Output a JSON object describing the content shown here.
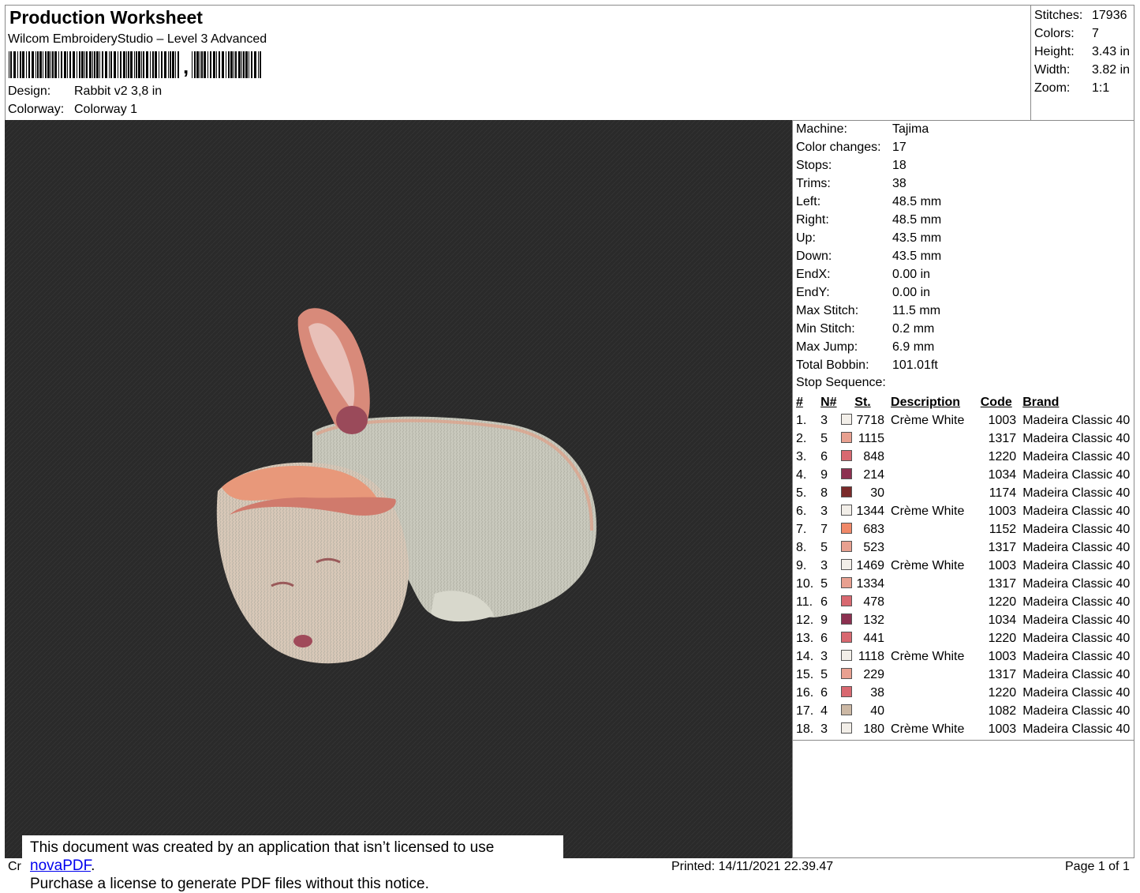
{
  "header": {
    "title": "Production Worksheet",
    "software": "Wilcom EmbroideryStudio – Level 3 Advanced",
    "design_label": "Design:",
    "design_value": "Rabbit v2 3,8 in",
    "colorway_label": "Colorway:",
    "colorway_value": "Colorway 1"
  },
  "stats": [
    {
      "label": "Stitches:",
      "value": "17936"
    },
    {
      "label": "Colors:",
      "value": "7"
    },
    {
      "label": "Height:",
      "value": "3.43 in"
    },
    {
      "label": "Width:",
      "value": "3.82 in"
    },
    {
      "label": "Zoom:",
      "value": "1:1"
    }
  ],
  "machine_info": [
    {
      "label": "Machine:",
      "value": "Tajima"
    },
    {
      "label": "Color changes:",
      "value": "17"
    },
    {
      "label": "Stops:",
      "value": "18"
    },
    {
      "label": "Trims:",
      "value": "38"
    },
    {
      "label": "Left:",
      "value": "48.5 mm"
    },
    {
      "label": "Right:",
      "value": "48.5 mm"
    },
    {
      "label": "Up:",
      "value": "43.5 mm"
    },
    {
      "label": "Down:",
      "value": "43.5 mm"
    },
    {
      "label": "EndX:",
      "value": "0.00 in"
    },
    {
      "label": "EndY:",
      "value": "0.00 in"
    },
    {
      "label": "Max Stitch:",
      "value": "11.5 mm"
    },
    {
      "label": "Min Stitch:",
      "value": "0.2 mm"
    },
    {
      "label": "Max Jump:",
      "value": "6.9 mm"
    },
    {
      "label": "Total Bobbin:",
      "value": "101.01ft"
    }
  ],
  "stop_sequence": {
    "title": "Stop Sequence:",
    "headers": {
      "idx": "#",
      "n": "N#",
      "st": "St.",
      "desc": "Description",
      "code": "Code",
      "brand": "Brand"
    },
    "rows": [
      {
        "idx": "1.",
        "n": "3",
        "color": "#f2eee8",
        "st": "7718",
        "desc": "Crème White",
        "code": "1003",
        "brand": "Madeira Classic 40"
      },
      {
        "idx": "2.",
        "n": "5",
        "color": "#e8a090",
        "st": "1115",
        "desc": "",
        "code": "1317",
        "brand": "Madeira Classic 40"
      },
      {
        "idx": "3.",
        "n": "6",
        "color": "#d86870",
        "st": "848",
        "desc": "",
        "code": "1220",
        "brand": "Madeira Classic 40"
      },
      {
        "idx": "4.",
        "n": "9",
        "color": "#8c3050",
        "st": "214",
        "desc": "",
        "code": "1034",
        "brand": "Madeira Classic 40"
      },
      {
        "idx": "5.",
        "n": "8",
        "color": "#7a2a2a",
        "st": "30",
        "desc": "",
        "code": "1174",
        "brand": "Madeira Classic 40"
      },
      {
        "idx": "6.",
        "n": "3",
        "color": "#f2eee8",
        "st": "1344",
        "desc": "Crème White",
        "code": "1003",
        "brand": "Madeira Classic 40"
      },
      {
        "idx": "7.",
        "n": "7",
        "color": "#f08868",
        "st": "683",
        "desc": "",
        "code": "1152",
        "brand": "Madeira Classic 40"
      },
      {
        "idx": "8.",
        "n": "5",
        "color": "#e8a090",
        "st": "523",
        "desc": "",
        "code": "1317",
        "brand": "Madeira Classic 40"
      },
      {
        "idx": "9.",
        "n": "3",
        "color": "#f2eee8",
        "st": "1469",
        "desc": "Crème White",
        "code": "1003",
        "brand": "Madeira Classic 40"
      },
      {
        "idx": "10.",
        "n": "5",
        "color": "#e8a090",
        "st": "1334",
        "desc": "",
        "code": "1317",
        "brand": "Madeira Classic 40"
      },
      {
        "idx": "11.",
        "n": "6",
        "color": "#d86870",
        "st": "478",
        "desc": "",
        "code": "1220",
        "brand": "Madeira Classic 40"
      },
      {
        "idx": "12.",
        "n": "9",
        "color": "#8c3050",
        "st": "132",
        "desc": "",
        "code": "1034",
        "brand": "Madeira Classic 40"
      },
      {
        "idx": "13.",
        "n": "6",
        "color": "#d86870",
        "st": "441",
        "desc": "",
        "code": "1220",
        "brand": "Madeira Classic 40"
      },
      {
        "idx": "14.",
        "n": "3",
        "color": "#f2eee8",
        "st": "1118",
        "desc": "Crème White",
        "code": "1003",
        "brand": "Madeira Classic 40"
      },
      {
        "idx": "15.",
        "n": "5",
        "color": "#e8a090",
        "st": "229",
        "desc": "",
        "code": "1317",
        "brand": "Madeira Classic 40"
      },
      {
        "idx": "16.",
        "n": "6",
        "color": "#d86870",
        "st": "38",
        "desc": "",
        "code": "1220",
        "brand": "Madeira Classic 40"
      },
      {
        "idx": "17.",
        "n": "4",
        "color": "#ccb8a4",
        "st": "40",
        "desc": "",
        "code": "1082",
        "brand": "Madeira Classic 40"
      },
      {
        "idx": "18.",
        "n": "3",
        "color": "#f2eee8",
        "st": "180",
        "desc": "Crème White",
        "code": "1003",
        "brand": "Madeira Classic 40"
      }
    ]
  },
  "footer": {
    "cr": "Cr",
    "printed": "Printed: 14/11/2021 22.39.47",
    "page": "Page 1 of 1"
  },
  "notice": {
    "line1_prefix": "This document was created by an application that isn’t licensed to use ",
    "link": "novaPDF",
    "line1_suffix": ".",
    "line2": "Purchase a license to generate PDF files without this notice."
  },
  "colors": {
    "preview_background": "#2a2a2a",
    "frame_border": "#8a8a8a",
    "link": "#0000ee"
  }
}
